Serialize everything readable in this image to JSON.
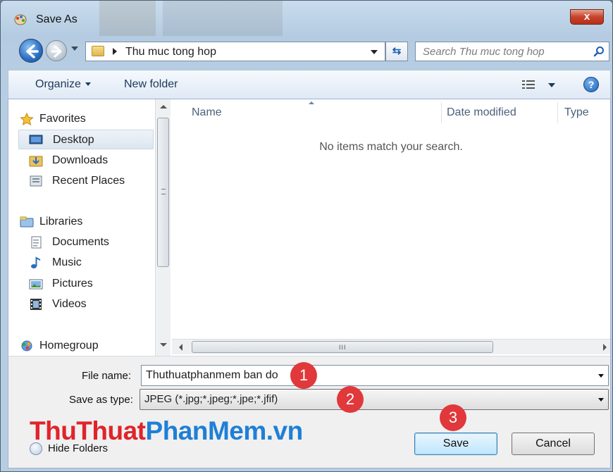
{
  "window": {
    "title": "Save As",
    "close_label": "x"
  },
  "address": {
    "path": "Thu muc tong hop",
    "search_placeholder": "Search Thu muc tong hop"
  },
  "toolbar": {
    "organize_label": "Organize",
    "new_folder_label": "New folder",
    "help_label": "?"
  },
  "nav": {
    "favorites_label": "Favorites",
    "favorites": [
      "Desktop",
      "Downloads",
      "Recent Places"
    ],
    "libraries_label": "Libraries",
    "libraries": [
      "Documents",
      "Music",
      "Pictures",
      "Videos"
    ],
    "homegroup_label": "Homegroup"
  },
  "file_list": {
    "columns": [
      "Name",
      "Date modified",
      "Type"
    ],
    "empty_message": "No items match your search.",
    "hscroll_grip": "III"
  },
  "form": {
    "file_name_label": "File name:",
    "file_name_value": "Thuthuatphanmem ban do",
    "save_type_label": "Save as type:",
    "save_type_value": "JPEG (*.jpg;*.jpeg;*.jpe;*.jfif)",
    "hide_folders_label": "Hide Folders",
    "save_label": "Save",
    "cancel_label": "Cancel"
  },
  "annotations": {
    "step1": "1",
    "step2": "2",
    "step3": "3",
    "watermark_part1": "ThuThuat",
    "watermark_part2": "PhanMem.vn"
  },
  "colors": {
    "badge": "#e0383b",
    "watermark_red": "#e0242a",
    "watermark_blue": "#1f7fd6"
  }
}
